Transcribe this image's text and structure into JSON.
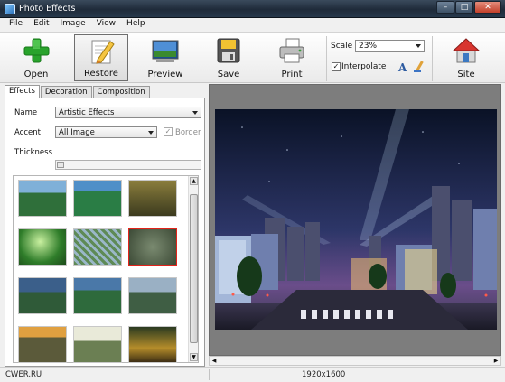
{
  "window": {
    "title": "Photo Effects"
  },
  "menu": [
    "File",
    "Edit",
    "Image",
    "View",
    "Help"
  ],
  "toolbar": {
    "open_label": "Open",
    "restore_label": "Restore",
    "preview_label": "Preview",
    "save_label": "Save",
    "print_label": "Print",
    "site_label": "Site",
    "scale_label": "Scale",
    "scale_value": "23%",
    "interpolate_label": "Interpolate",
    "interpolate_checked": true
  },
  "tabs": [
    "Effects",
    "Decoration",
    "Composition"
  ],
  "effects": {
    "name_label": "Name",
    "name_value": "Artistic Effects",
    "accent_label": "Accent",
    "accent_value": "All Image",
    "border_label": "Border",
    "border_checked": true,
    "thickness_label": "Thickness"
  },
  "thumbnails": {
    "count": 12,
    "selected_index": 5
  },
  "status": {
    "left_text": "CWER.RU",
    "dimensions": "1920x1600"
  },
  "colors": {
    "selection": "#e2231a",
    "preview_bg": "#7d7d7d"
  }
}
